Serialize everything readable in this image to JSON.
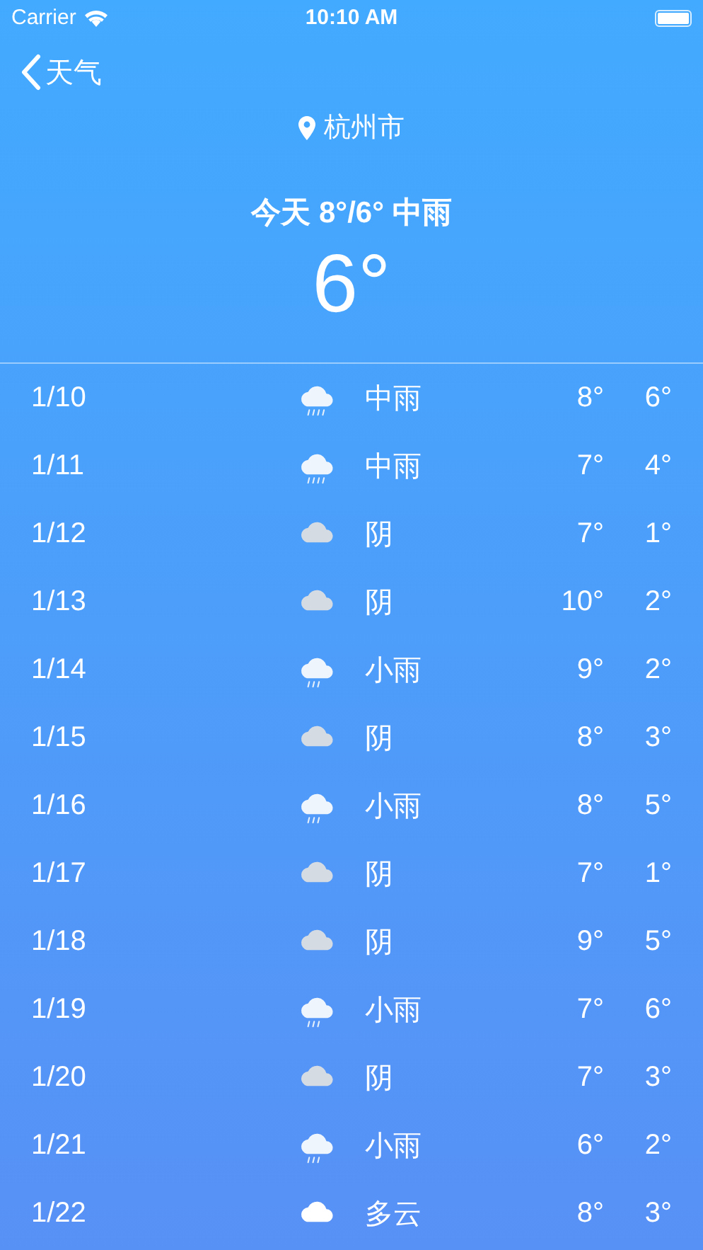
{
  "status_bar": {
    "carrier": "Carrier",
    "time": "10:10 AM"
  },
  "nav": {
    "back_label": "天气"
  },
  "location": "杭州市",
  "summary": "今天 8°/6° 中雨",
  "current_temp": "6°",
  "forecast": [
    {
      "date": "1/10",
      "kind": "moderate_rain",
      "condition": "中雨",
      "high": "8°",
      "low": "6°"
    },
    {
      "date": "1/11",
      "kind": "moderate_rain",
      "condition": "中雨",
      "high": "7°",
      "low": "4°"
    },
    {
      "date": "1/12",
      "kind": "overcast",
      "condition": "阴",
      "high": "7°",
      "low": "1°"
    },
    {
      "date": "1/13",
      "kind": "overcast",
      "condition": "阴",
      "high": "10°",
      "low": "2°"
    },
    {
      "date": "1/14",
      "kind": "light_rain",
      "condition": "小雨",
      "high": "9°",
      "low": "2°"
    },
    {
      "date": "1/15",
      "kind": "overcast",
      "condition": "阴",
      "high": "8°",
      "low": "3°"
    },
    {
      "date": "1/16",
      "kind": "light_rain",
      "condition": "小雨",
      "high": "8°",
      "low": "5°"
    },
    {
      "date": "1/17",
      "kind": "overcast",
      "condition": "阴",
      "high": "7°",
      "low": "1°"
    },
    {
      "date": "1/18",
      "kind": "overcast",
      "condition": "阴",
      "high": "9°",
      "low": "5°"
    },
    {
      "date": "1/19",
      "kind": "light_rain",
      "condition": "小雨",
      "high": "7°",
      "low": "6°"
    },
    {
      "date": "1/20",
      "kind": "overcast",
      "condition": "阴",
      "high": "7°",
      "low": "3°"
    },
    {
      "date": "1/21",
      "kind": "light_rain",
      "condition": "小雨",
      "high": "6°",
      "low": "2°"
    },
    {
      "date": "1/22",
      "kind": "cloudy",
      "condition": "多云",
      "high": "8°",
      "low": "3°"
    }
  ]
}
